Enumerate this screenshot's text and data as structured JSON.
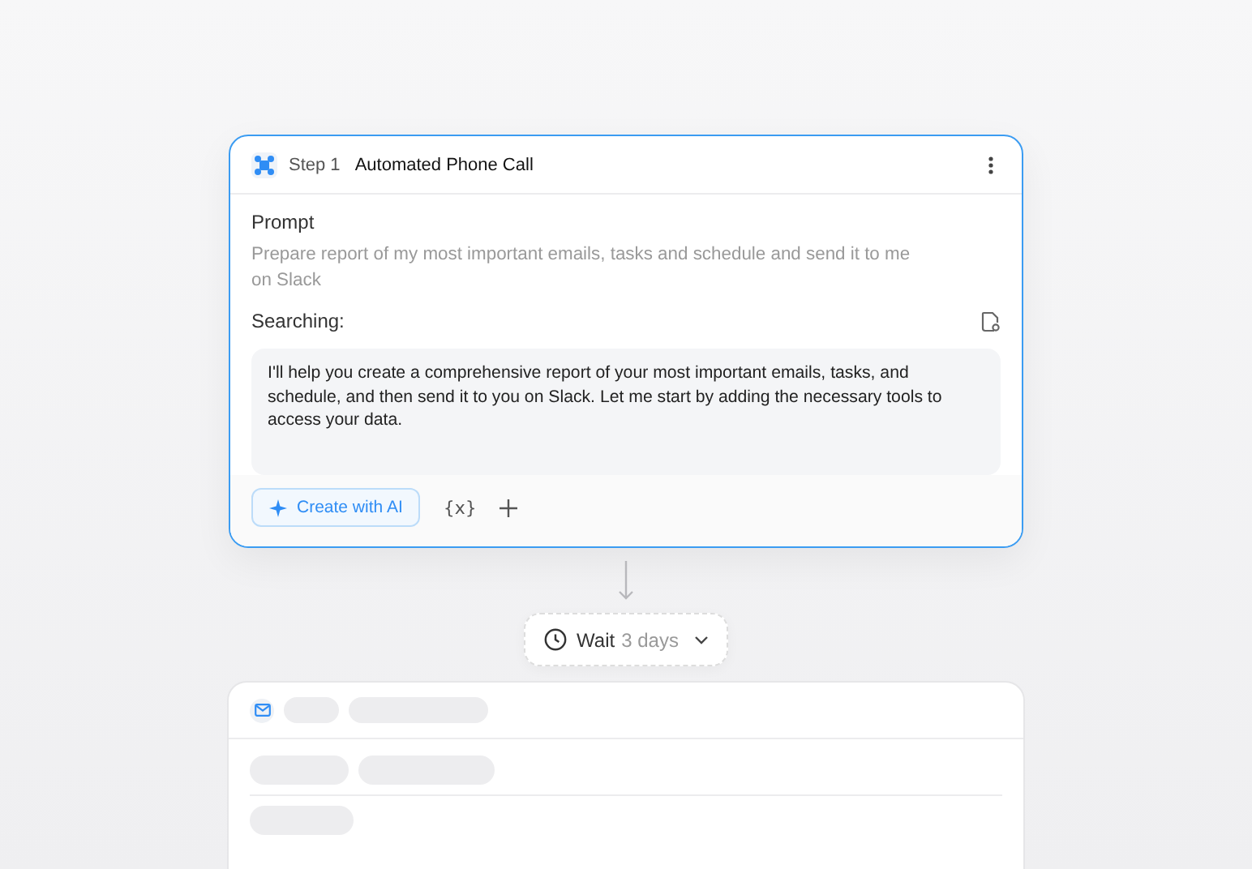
{
  "step_card": {
    "step_label": "Step 1",
    "title": "Automated Phone Call",
    "prompt_label": "Prompt",
    "prompt_text": "Prepare report of my most important emails, tasks and schedule and send it to me on Slack",
    "searching_label": "Searching:",
    "response": "I'll help you create a comprehensive report of your most important emails, tasks, and schedule, and then send it to you on Slack. Let me start by adding the necessary tools to access your data.",
    "create_button": "Create with AI",
    "variable_button": "{x}"
  },
  "wait_pill": {
    "label": "Wait",
    "value": "3 days"
  }
}
